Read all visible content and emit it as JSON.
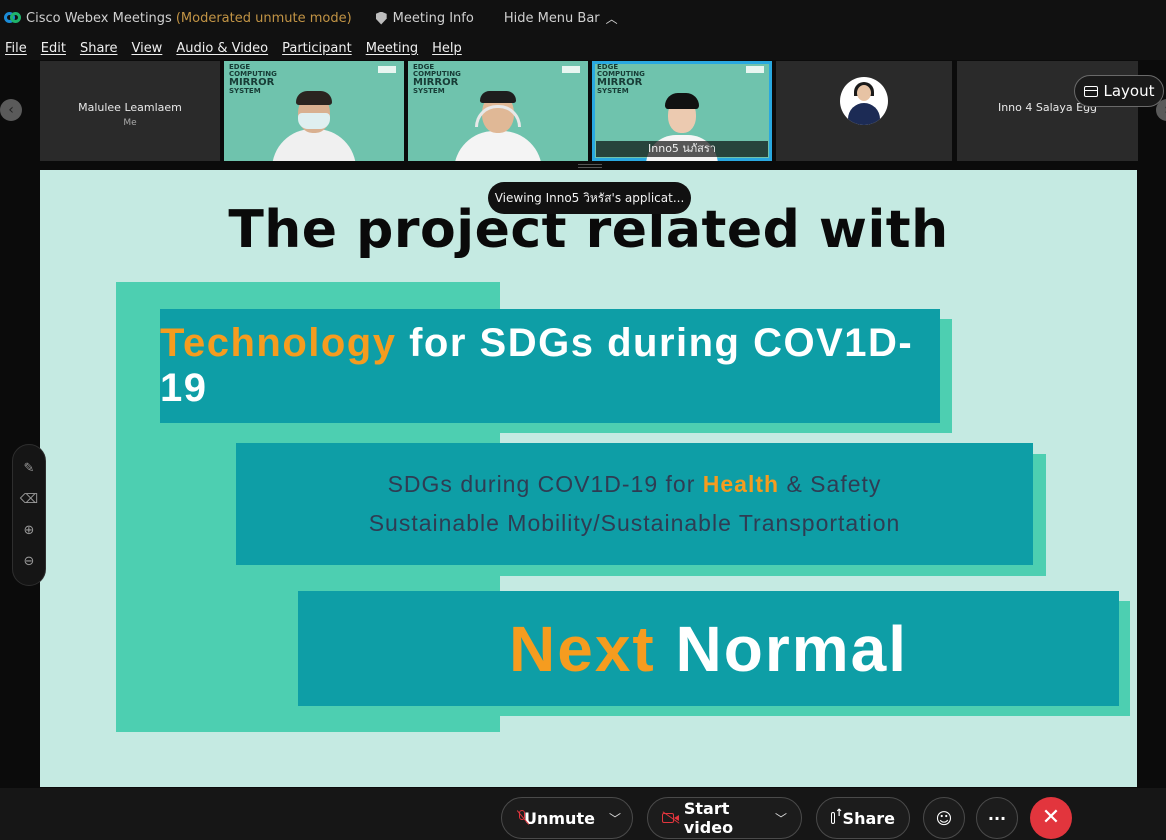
{
  "window": {
    "app_name": "Cisco Webex Meetings",
    "mode": "(Moderated unmute mode)",
    "meeting_info": "Meeting Info",
    "hide_menu_bar": "Hide Menu Bar"
  },
  "menu": [
    "File",
    "Edit",
    "Share",
    "View",
    "Audio & Video",
    "Participant",
    "Meeting",
    "Help"
  ],
  "participants": {
    "self_name": "Malulee Leamlaem",
    "self_tag": "Me",
    "video_brand_line1": "EDGE",
    "video_brand_line2": "COMPUTING",
    "video_brand_line3": "MIRROR",
    "video_brand_line4": "SYSTEM",
    "active_name": "Inno5 นภัสรา",
    "last_name": "Inno 4 Salaya Egg"
  },
  "layout_button": "Layout",
  "viewing_banner": "Viewing Inno5 วิหรัส's applicat...",
  "slide": {
    "title": "The project related with",
    "panel1_highlight": "Technology",
    "panel1_rest": " for SDGs during COV1D-19",
    "panel2_line1_pre": "SDGs during COV1D-19 for ",
    "panel2_line1_highlight": "Health",
    "panel2_line1_post": " & Safety",
    "panel2_line2": "Sustainable Mobility/Sustainable Transportation",
    "panel3_highlight": "Next",
    "panel3_rest": " Normal"
  },
  "controls": {
    "unmute": "Unmute",
    "start_video": "Start video",
    "share": "Share",
    "more": "···",
    "end": "✕"
  },
  "colors": {
    "accent_orange": "#f59c1f",
    "panel_teal": "#0e9ea6",
    "deco_green": "#4dcfb1",
    "end_red": "#e2353d",
    "active_blue": "#29a8e0"
  }
}
